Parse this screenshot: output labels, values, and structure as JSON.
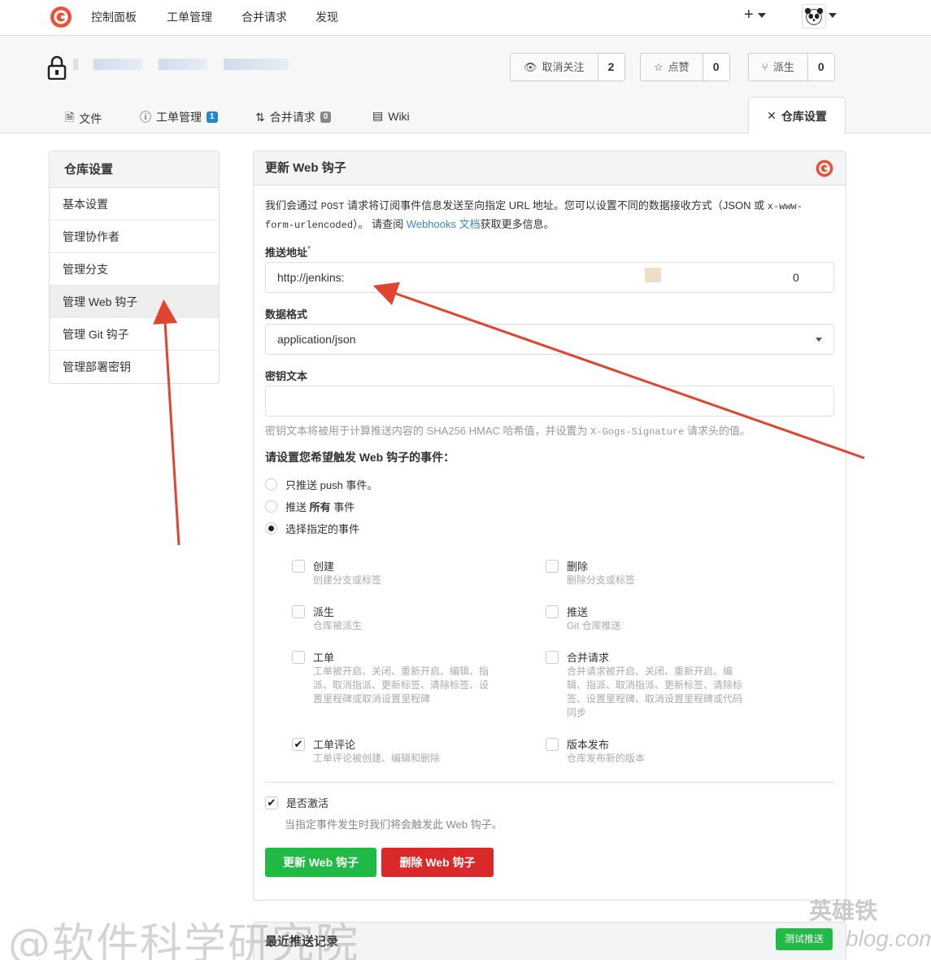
{
  "topnav": {
    "links": [
      "控制面板",
      "工单管理",
      "合并请求",
      "发现"
    ],
    "plus": "+"
  },
  "repo": {
    "stats": [
      {
        "label": "取消关注",
        "count": "2",
        "icon": "eye-icon"
      },
      {
        "label": "点赞",
        "count": "0",
        "icon": "star-icon"
      },
      {
        "label": "派生",
        "count": "0",
        "icon": "fork-icon"
      }
    ],
    "tabs": [
      {
        "label": "文件",
        "icon": "file-icon"
      },
      {
        "label": "工单管理",
        "icon": "issue-icon",
        "badge": "1"
      },
      {
        "label": "合并请求",
        "icon": "pull-request-icon",
        "badge": "0"
      },
      {
        "label": "Wiki",
        "icon": "wiki-icon"
      }
    ],
    "active_tab": "仓库设置"
  },
  "sidebar": {
    "title": "仓库设置",
    "items": [
      "基本设置",
      "管理协作者",
      "管理分支",
      "管理 Web 钩子",
      "管理 Git 钩子",
      "管理部署密钥"
    ],
    "active_index": 3
  },
  "form": {
    "title": "更新 Web 钩子",
    "desc_part1": "我们会通过",
    "desc_post": "POST",
    "desc_part2": "请求将订阅事件信息发送至向指定 URL 地址。您可以设置不同的数据接收方式（JSON 或",
    "desc_mime": "x-www-form-urlencoded",
    "desc_part3": "）。 请查阅",
    "desc_link": "Webhooks 文档",
    "desc_part4": "获取更多信息。",
    "url_label": "推送地址",
    "required_mark": "*",
    "url_value": "http://jenkins:",
    "url_suffix": "0",
    "format_label": "数据格式",
    "format_value": "application/json",
    "secret_label": "密钥文本",
    "secret_help_1": "密钥文本将被用于计算推送内容的 SHA256 HMAC 哈希值，并设置为",
    "secret_help_header": "X-Gogs-Signature",
    "secret_help_2": "请求头的值。",
    "events_title": "请设置您希望触发 Web 钩子的事件：",
    "radio_push": "只推送 push 事件。",
    "radio_all_a": "推送",
    "radio_all_b": "所有",
    "radio_all_c": "事件",
    "radio_choose": "选择指定的事件",
    "events": [
      {
        "title": "创建",
        "desc": "创建分支或标签",
        "checked": false
      },
      {
        "title": "删除",
        "desc": "删除分支或标签",
        "checked": false
      },
      {
        "title": "派生",
        "desc": "仓库被派生",
        "checked": false
      },
      {
        "title": "推送",
        "desc": "Git 仓库推送",
        "checked": false
      },
      {
        "title": "工单",
        "desc": "工单被开启、关闭、重新开启、编辑、指派、取消指派、更新标签、清除标签、设置里程碑或取消设置里程碑",
        "checked": false
      },
      {
        "title": "合并请求",
        "desc": "合并请求被开启、关闭、重新开启、编辑、指派、取消指派、更新标签、清除标签、设置里程碑、取消设置里程碑或代码同步",
        "checked": false
      },
      {
        "title": "工单评论",
        "desc": "工单评论被创建、编辑和删除",
        "checked": true
      },
      {
        "title": "版本发布",
        "desc": "仓库发布新的版本",
        "checked": false
      }
    ],
    "active_label": "是否激活",
    "active_help": "当指定事件发生时我们将会触发此 Web 钩子。",
    "update_btn": "更新 Web 钩子",
    "delete_btn": "删除 Web 钩子"
  },
  "recent": {
    "title": "最近推送记录",
    "test_btn": "测试推送"
  },
  "watermark": {
    "left": "@软件科学研究院",
    "right_top": "英雄铁",
    "right_bottom": "blog.com"
  },
  "colors": {
    "green": "#21ba45",
    "red": "#db2828",
    "arrow": "#e0452f",
    "link": "#4183c4"
  }
}
